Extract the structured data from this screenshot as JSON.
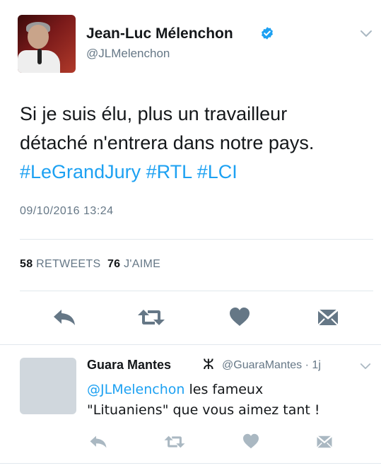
{
  "tweet": {
    "author_name": "Jean-Luc Mélenchon",
    "author_handle": "@JLMelenchon",
    "text_line1": "Si je suis élu, plus un travailleur",
    "text_line2": "détaché n'entrera dans notre pays.",
    "hashtag1": "#LeGrandJury",
    "hashtag2": "#RTL",
    "hashtag3": "#LCI",
    "timestamp": "09/10/2016 13:24",
    "retweets_count": "58",
    "retweets_label": "RETWEETS",
    "likes_count": "76",
    "likes_label": "J'AIME"
  },
  "reply": {
    "author_name": "Guara Mantes",
    "author_symbol": "ⵣ",
    "author_handle": "@GuaraMantes",
    "separator": "·",
    "age": "1j",
    "mention": "@JLMelenchon",
    "text_rest": " les fameux",
    "text_line2": "\"Lituaniens\" que vous aimez tant !"
  },
  "colors": {
    "accent": "#1da1f2",
    "muted": "#657786",
    "icon": "#657786",
    "icon_faint": "#aab8c2",
    "divider": "#e1e8ed"
  },
  "icons": [
    "verified-badge-icon",
    "chevron-down-icon",
    "reply-icon",
    "retweet-icon",
    "heart-icon",
    "direct-message-icon"
  ]
}
